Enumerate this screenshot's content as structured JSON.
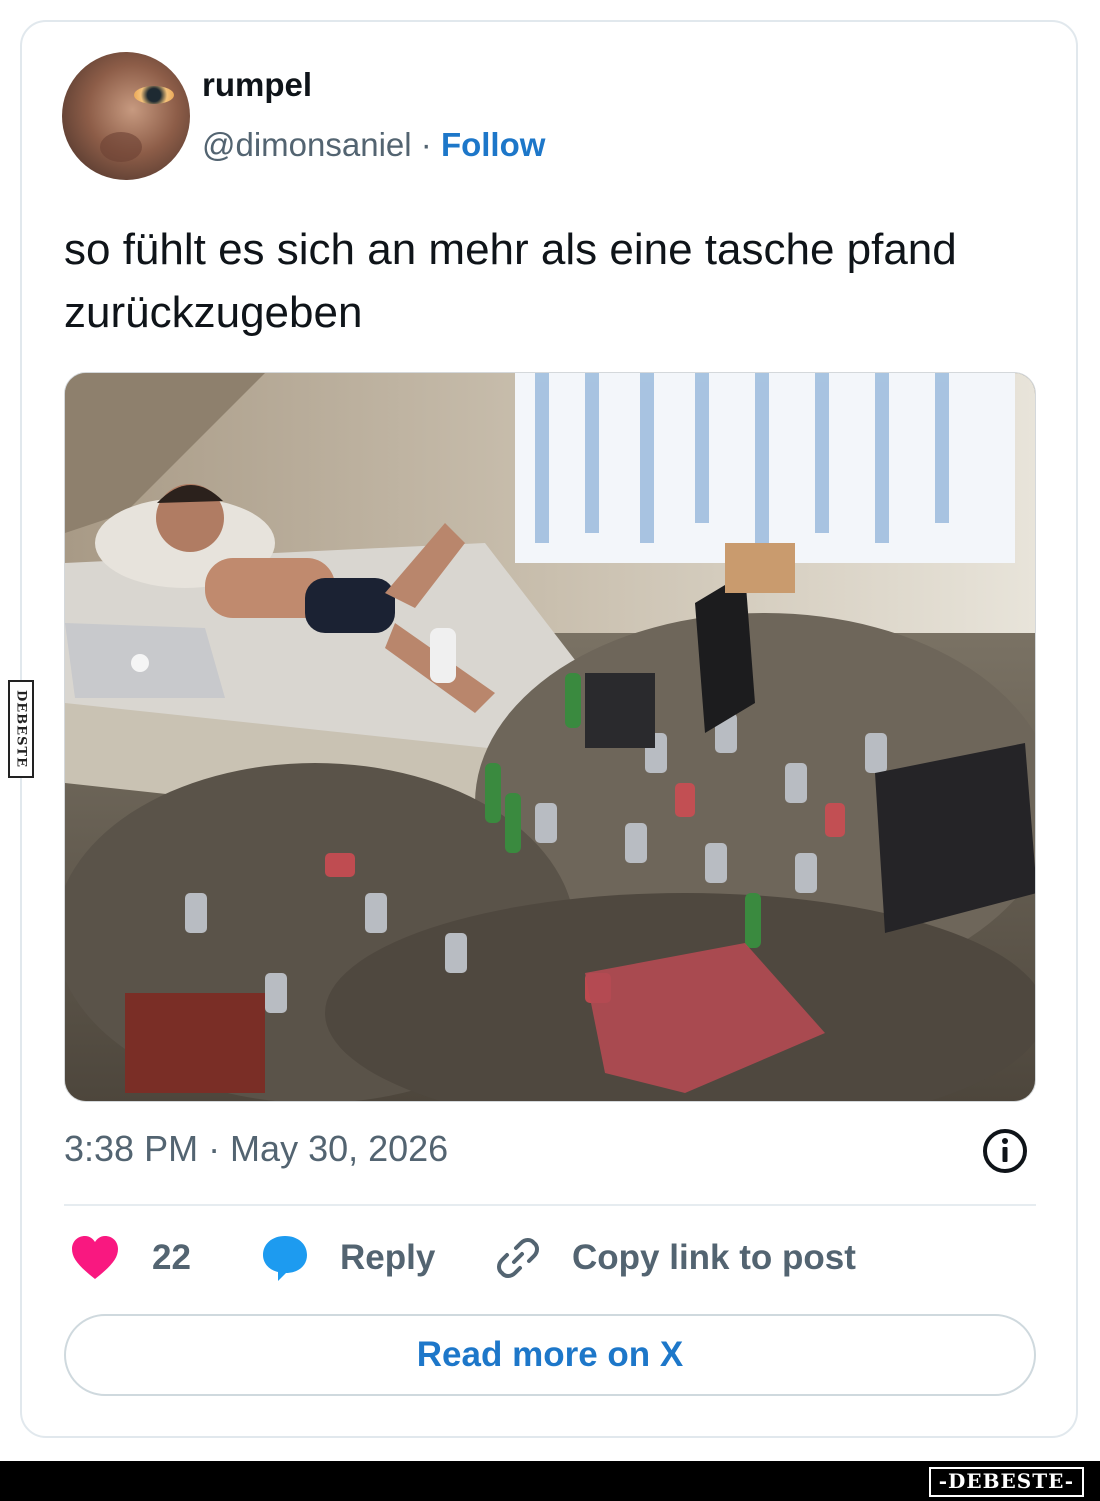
{
  "tweet": {
    "author_name": "rumpel",
    "handle": "@dimonsaniel",
    "separator": " · ",
    "follow_label": "Follow",
    "text": "so fühlt es sich an mehr als eine tasche pfand zurückzugeben",
    "timestamp": "3:38 PM · May 30, 2026",
    "likes": "22",
    "reply_label": "Reply",
    "copy_link_label": "Copy link to post",
    "read_more_label": "Read more on X"
  },
  "icons": {
    "like": "heart-icon",
    "reply": "speech-bubble-icon",
    "copy_link": "link-icon",
    "info": "info-icon"
  },
  "colors": {
    "like": "#f91880",
    "reply": "#1d9bf0",
    "link_text": "#1d77c9",
    "secondary_text": "#536471"
  },
  "watermark": {
    "side": "DEBESTE",
    "bottom": "-DEBESTE-"
  }
}
